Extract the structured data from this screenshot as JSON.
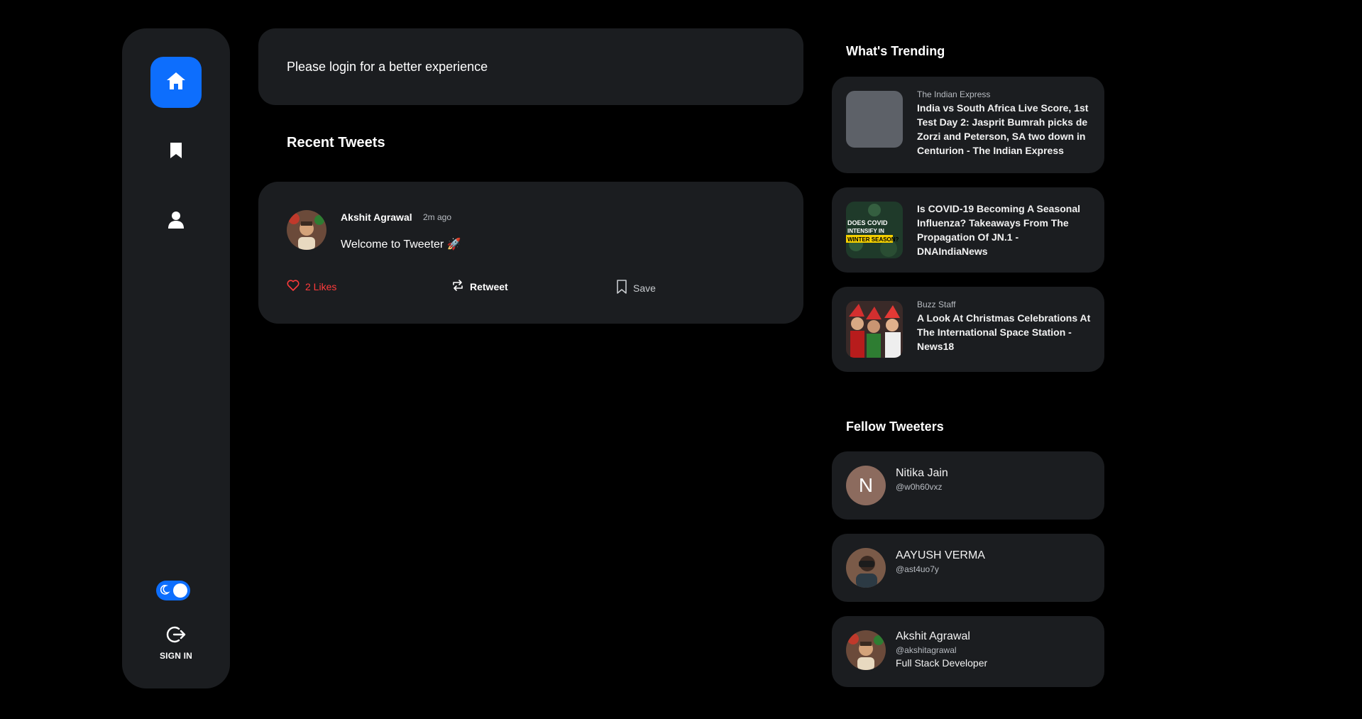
{
  "sidebar": {
    "items": [
      {
        "name": "home",
        "icon": "home-icon",
        "active": true
      },
      {
        "name": "bookmarks",
        "icon": "bookmark-icon",
        "active": false
      },
      {
        "name": "profile",
        "icon": "user-icon",
        "active": false
      }
    ],
    "theme_toggle": {
      "icon": "moon-icon",
      "dark_mode": true
    },
    "signin_label": "SIGN IN",
    "signin_icon": "logout-icon"
  },
  "banner": {
    "text": "Please login for a better experience"
  },
  "recent": {
    "title": "Recent Tweets",
    "tweets": [
      {
        "author": "Akshit Agrawal",
        "time": "2m ago",
        "text": "Welcome to Tweeter 🚀",
        "likes_label": "2 Likes",
        "retweet_label": "Retweet",
        "save_label": "Save"
      }
    ]
  },
  "trending": {
    "title": "What's Trending",
    "items": [
      {
        "source": "The Indian Express",
        "headline": "India vs South Africa Live Score, 1st Test Day 2: Jasprit Bumrah picks de Zorzi and Peterson, SA two down in Centurion - The Indian Express"
      },
      {
        "source": "",
        "headline": "Is COVID-19 Becoming A Seasonal Influenza? Takeaways From The Propagation Of JN.1 - DNAIndiaNews",
        "thumb_text": [
          "DOES COVID",
          "INTENSIFY IN",
          "WINTER SEASON?"
        ]
      },
      {
        "source": "Buzz Staff",
        "headline": "A Look At Christmas Celebrations At The International Space Station - News18"
      }
    ]
  },
  "fellow": {
    "title": "Fellow Tweeters",
    "users": [
      {
        "name": "Nitika Jain",
        "handle": "@w0h60vxz",
        "initial": "N",
        "bio": ""
      },
      {
        "name": "AAYUSH VERMA",
        "handle": "@ast4uo7y",
        "initial": "",
        "bio": ""
      },
      {
        "name": "Akshit Agrawal",
        "handle": "@akshitagrawal",
        "initial": "",
        "bio": "Full Stack Developer"
      }
    ]
  },
  "colors": {
    "accent": "#0d6efd",
    "panel": "#1b1d20",
    "like": "#ff3b3b",
    "background": "#000000"
  }
}
